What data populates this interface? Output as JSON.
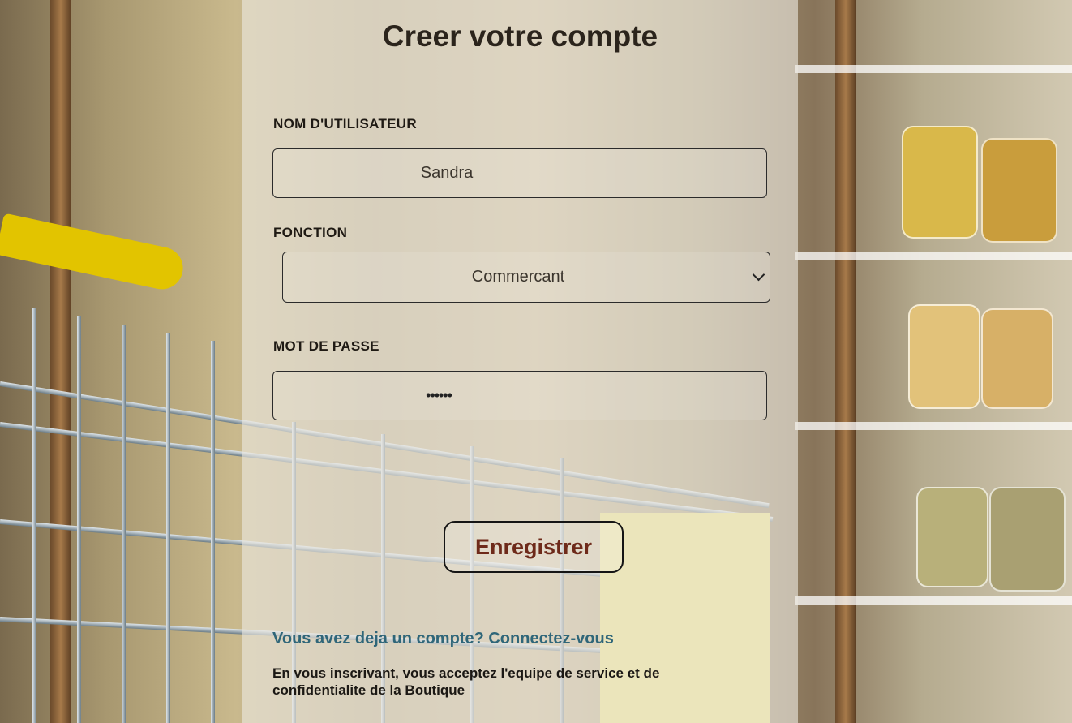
{
  "page": {
    "title": "Creer votre compte"
  },
  "form": {
    "username_label": "NOM D'UTILISATEUR",
    "username_value": "Sandra",
    "function_label": "FONCTION",
    "function_value": "Commercant",
    "password_label": "MOT DE PASSE",
    "password_value": "••••••",
    "submit_label": "Enregistrer"
  },
  "footer": {
    "login_link": "Vous avez deja un compte? Connectez-vous",
    "terms": "En vous inscrivant, vous acceptez l'equipe de service et de confidentialite de la Boutique"
  },
  "colors": {
    "title": "#2b241c",
    "button_text": "#6e2a1a",
    "link": "#2f6679"
  }
}
